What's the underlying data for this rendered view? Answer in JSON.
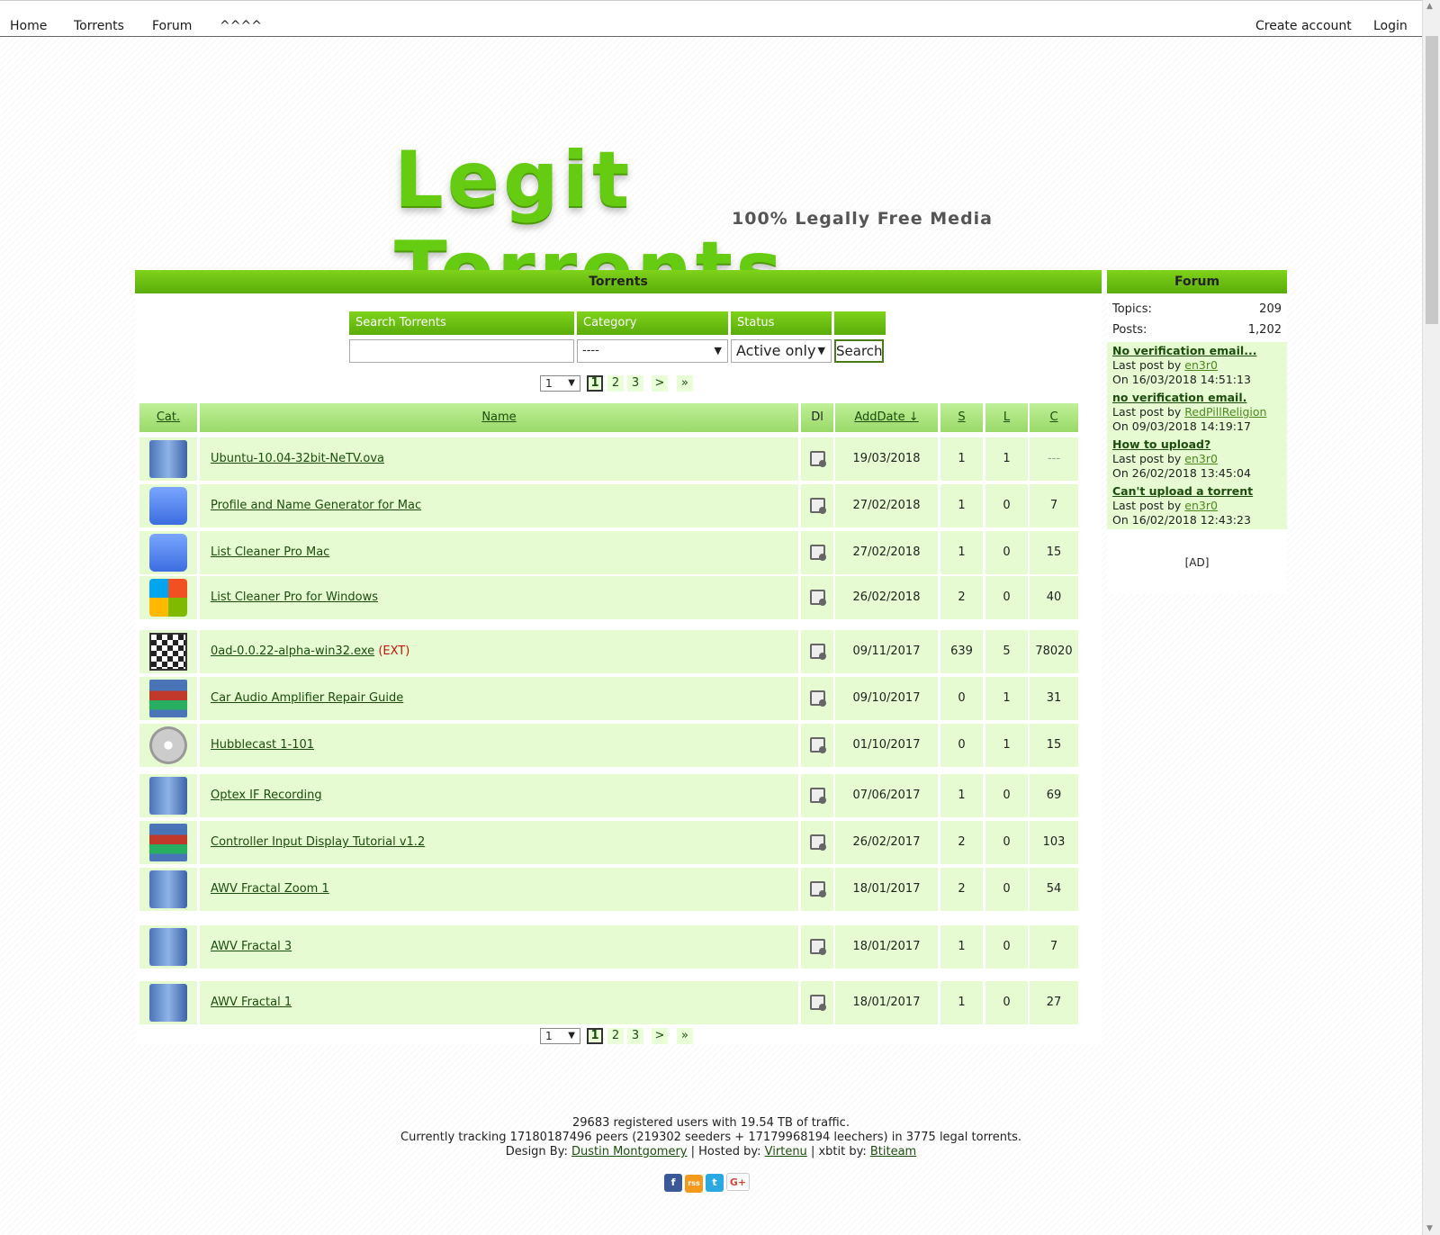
{
  "nav": {
    "home": "Home",
    "torrents": "Torrents",
    "forum": "Forum",
    "extra": "^^^^",
    "create_account": "Create account",
    "login": "Login"
  },
  "logo": {
    "title": "Legit Torrents",
    "subtitle": "100% Legally Free Media"
  },
  "torrents_panel": {
    "title": "Torrents",
    "search": {
      "search_label": "Search Torrents",
      "search_value": "",
      "category_label": "Category",
      "category_value": "----",
      "status_label": "Status",
      "status_value": "Active only",
      "button": "Search"
    },
    "pager": {
      "select_value": "1",
      "pages": [
        "1",
        "2",
        "3"
      ],
      "next": ">",
      "last": "»"
    },
    "table": {
      "headers": {
        "cat": "Cat.",
        "name": "Name",
        "dl": "Dl",
        "adddate": "AddDate ↓",
        "s": "S",
        "l": "L",
        "c": "C"
      },
      "rows": [
        {
          "name": "Ubuntu-10.04-32bit-NeTV.ova",
          "ext": "",
          "date": "19/03/2018",
          "s": "1",
          "l": "1",
          "c": "---",
          "icon": "server-icon"
        },
        {
          "name": "Profile and Name Generator for Mac",
          "ext": "",
          "date": "27/02/2018",
          "s": "1",
          "l": "0",
          "c": "7",
          "icon": "mac-finder-icon"
        },
        {
          "name": "List Cleaner Pro Mac",
          "ext": "",
          "date": "27/02/2018",
          "s": "1",
          "l": "0",
          "c": "15",
          "icon": "mac-finder-icon"
        },
        {
          "name": "List Cleaner Pro for Windows",
          "ext": "",
          "date": "26/02/2018",
          "s": "2",
          "l": "0",
          "c": "40",
          "icon": "windows-icon"
        },
        {
          "name": "0ad-0.0.22-alpha-win32.exe",
          "ext": "(EXT)",
          "date": "09/11/2017",
          "s": "639",
          "l": "5",
          "c": "78020",
          "icon": "game-checker-icon"
        },
        {
          "name": "Car Audio Amplifier Repair Guide",
          "ext": "",
          "date": "09/10/2017",
          "s": "0",
          "l": "1",
          "c": "31",
          "icon": "archive-icon"
        },
        {
          "name": "Hubblecast 1-101",
          "ext": "",
          "date": "01/10/2017",
          "s": "0",
          "l": "1",
          "c": "15",
          "icon": "dvd-icon"
        },
        {
          "name": "Optex IF Recording",
          "ext": "",
          "date": "07/06/2017",
          "s": "1",
          "l": "0",
          "c": "69",
          "icon": "server-icon"
        },
        {
          "name": "Controller Input Display Tutorial v1.2",
          "ext": "",
          "date": "26/02/2017",
          "s": "2",
          "l": "0",
          "c": "103",
          "icon": "archive-icon"
        },
        {
          "name": "AWV Fractal Zoom 1",
          "ext": "",
          "date": "18/01/2017",
          "s": "2",
          "l": "0",
          "c": "54",
          "icon": "server-icon"
        },
        {
          "name": "AWV Fractal 3",
          "ext": "",
          "date": "18/01/2017",
          "s": "1",
          "l": "0",
          "c": "7",
          "icon": "server-icon"
        },
        {
          "name": "AWV Fractal 1",
          "ext": "",
          "date": "18/01/2017",
          "s": "1",
          "l": "0",
          "c": "27",
          "icon": "server-icon"
        }
      ]
    }
  },
  "forum_panel": {
    "title": "Forum",
    "topics_label": "Topics:",
    "topics_value": "209",
    "posts_label": "Posts:",
    "posts_value": "1,202",
    "last_post_prefix": "Last post by",
    "posts": [
      {
        "title": "No verification email...",
        "by": "en3r0",
        "on": "On 16/03/2018 14:51:13"
      },
      {
        "title": "no verification email.",
        "by": "RedPillReligion",
        "on": "On 09/03/2018 14:19:17"
      },
      {
        "title": "How to upload?",
        "by": "en3r0",
        "on": "On 26/02/2018 13:45:04"
      },
      {
        "title": "Can't upload a torrent",
        "by": "en3r0",
        "on": "On 16/02/2018 12:43:23"
      }
    ],
    "ad": "[AD]"
  },
  "footer": {
    "line1": "29683 registered users with 19.54 TB of traffic.",
    "line2": "Currently tracking 17180187496 peers (219302 seeders + 17179968194 leechers) in 3775 legal torrents.",
    "design_by": "Design By:",
    "designer": "Dustin Montgomery",
    "hosted_by": "| Hosted by:",
    "host": "Virtenu",
    "xbtit_by": "| xbtit by:",
    "xbtit": "Btiteam",
    "social": [
      "f",
      "rss",
      "t",
      "G+"
    ]
  },
  "colors": {
    "accent_green": "#6ac017",
    "row_bg": "#e6fbd2",
    "ext_red": "#c0150c"
  }
}
